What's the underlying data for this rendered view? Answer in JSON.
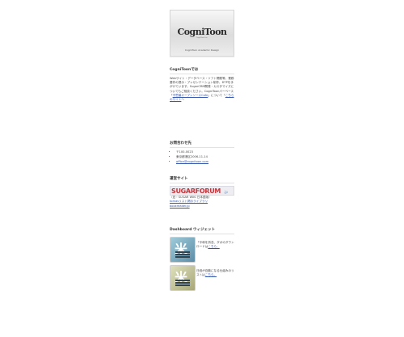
{
  "logo": {
    "wordmark": "CogniToon",
    "tagline": "CogniToon Inc.",
    "caption": "CogniToon Academic Design"
  },
  "about": {
    "title": "CogniToonでは",
    "text": "Webサイト・データベース・ソフト開発等、業務要件の提示・プレゼンテーション制作、DTPを手がけています。SugarCRM開発・カスタマイズについてもご相談ください。CogniToonパーベース「",
    "link1": "不思議オープンソースCafe",
    "text2": "」について「",
    "link2": "こちらのサイト",
    "text3": "へ"
  },
  "contact": {
    "title": "お問合わせ先",
    "items": [
      "〒100-0023",
      "東京都港区2006-11-14"
    ],
    "email": "office@cognitoon.com"
  },
  "sites": {
    "title": "運営サイト",
    "banner_main": "SUGARFORUM",
    "banner_sub": ".jp",
    "line1": "（旧・SUGAR WIKI 日本語版）",
    "link1": "tomasリスト掲示ライブラリ",
    "link2": "bookreader.jp"
  },
  "dashboard": {
    "title": "Dashboard ウィジェット",
    "widgets": [
      {
        "text": "「平和を祈念、ダボのダウンロードは",
        "link": "こちら。"
      },
      {
        "text": "日経が自動になる仕組みのリストは",
        "link": "こちら。"
      }
    ],
    "glyph": "米"
  }
}
